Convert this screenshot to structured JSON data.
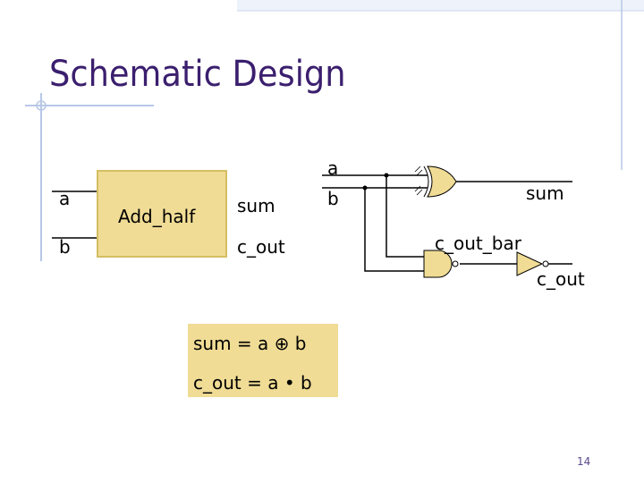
{
  "slide": {
    "title": "Schematic Design",
    "page_number": "14"
  },
  "block_diagram": {
    "block_label": "Add_half",
    "inputs": [
      "a",
      "b"
    ],
    "outputs": [
      "sum",
      "c_out"
    ]
  },
  "gate_schematic": {
    "inputs": [
      "a",
      "b"
    ],
    "outputs": [
      "sum",
      "c_out"
    ],
    "internal_signal": "c_out_bar",
    "gates": [
      "xor-gate",
      "nand-gate",
      "inverter"
    ]
  },
  "equations": {
    "sum_eq": "sum = a ⊕ b",
    "c_out_eq": "c_out = a • b"
  },
  "colors": {
    "title": "#3b1f6e",
    "gate_fill": "#f0dc95",
    "decor_line": "#b7c7e6"
  }
}
